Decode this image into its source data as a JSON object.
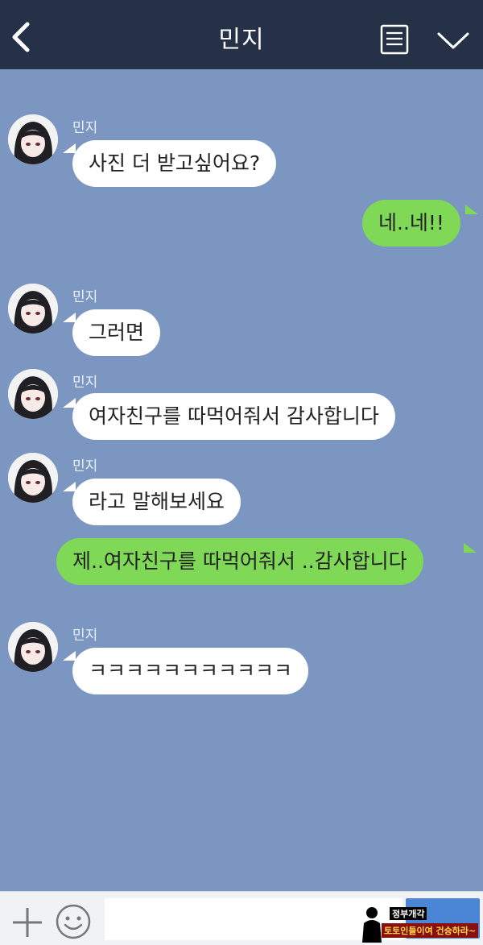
{
  "header": {
    "title": "민지",
    "background": "#253146",
    "back_icon": "chevron-left-icon",
    "menu_icon": "notepad-icon",
    "expand_icon": "chevron-down-icon"
  },
  "chat": {
    "background": "#7b96c1",
    "incoming_bubble_color": "#ffffff",
    "outgoing_bubble_color": "#7fd957",
    "messages": [
      {
        "direction": "in",
        "sender": "민지",
        "text": "사진 더 받고싶어요?"
      },
      {
        "direction": "out",
        "text": "네..네!!"
      },
      {
        "direction": "in",
        "sender": "민지",
        "text": "그러면"
      },
      {
        "direction": "in",
        "sender": "민지",
        "text": "여자친구를 따먹어줘서 감사합니다"
      },
      {
        "direction": "in",
        "sender": "민지",
        "text": "라고 말해보세요"
      },
      {
        "direction": "out",
        "text": "제..여자친구를 따먹어줘서 ..감사합니다"
      },
      {
        "direction": "in",
        "sender": "민지",
        "text": "ㅋㅋㅋㅋㅋㅋㅋㅋㅋㅋㅋ"
      }
    ]
  },
  "input": {
    "plus_icon": "plus-icon",
    "emoji_icon": "smiley-icon",
    "send_color": "#4b86d6"
  },
  "watermark": {
    "line1": "정부개각",
    "line2": "토토인들이여 건승하라~"
  }
}
